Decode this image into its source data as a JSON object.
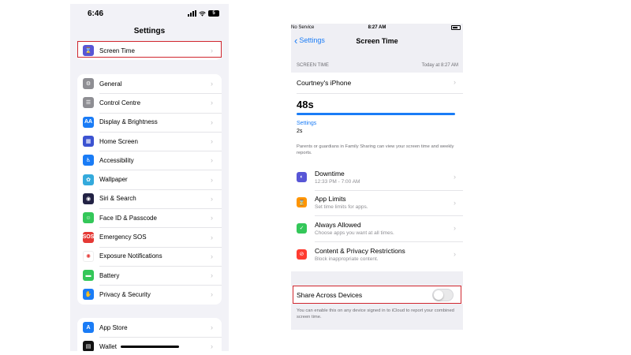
{
  "left_phone": {
    "status_bar": {
      "time": "6:46",
      "battery": "5"
    },
    "title": "Settings",
    "top_group": [
      {
        "label": "Screen Time",
        "icon": "hourglass-icon",
        "color": "#5856d6",
        "glyph": "⌛"
      }
    ],
    "main_group": [
      {
        "label": "General",
        "icon": "gear-icon",
        "color": "#8e8e93",
        "glyph": "⚙"
      },
      {
        "label": "Control Centre",
        "icon": "control-centre-icon",
        "color": "#8e8e93",
        "glyph": "☰"
      },
      {
        "label": "Display & Brightness",
        "icon": "display-icon",
        "color": "#1a7cf6",
        "glyph": "AA"
      },
      {
        "label": "Home Screen",
        "icon": "home-screen-icon",
        "color": "#3c53d1",
        "glyph": "▦"
      },
      {
        "label": "Accessibility",
        "icon": "accessibility-icon",
        "color": "#1a7cf6",
        "glyph": "♿"
      },
      {
        "label": "Wallpaper",
        "icon": "wallpaper-icon",
        "color": "#34aadc",
        "glyph": "✿"
      },
      {
        "label": "Siri & Search",
        "icon": "siri-icon",
        "color": "#222244",
        "glyph": "◉"
      },
      {
        "label": "Face ID & Passcode",
        "icon": "face-id-icon",
        "color": "#34c759",
        "glyph": "☺"
      },
      {
        "label": "Emergency SOS",
        "icon": "sos-icon",
        "color": "#e53935",
        "glyph": "SOS"
      },
      {
        "label": "Exposure Notifications",
        "icon": "exposure-icon",
        "color": "#ffffff",
        "glyph": "✺"
      },
      {
        "label": "Battery",
        "icon": "battery-icon",
        "color": "#34c759",
        "glyph": "▬"
      },
      {
        "label": "Privacy & Security",
        "icon": "hand-icon",
        "color": "#1a7cf6",
        "glyph": "✋"
      }
    ],
    "bottom_group": [
      {
        "label": "App Store",
        "icon": "app-store-icon",
        "color": "#1a7cf6",
        "glyph": "A"
      },
      {
        "label": "Wallet",
        "icon": "wallet-icon",
        "color": "#111111",
        "glyph": "▤"
      }
    ]
  },
  "right_phone": {
    "status_bar": {
      "carrier": "No Service",
      "time": "8:27 AM"
    },
    "nav": {
      "back": "Settings",
      "title": "Screen Time"
    },
    "section_header": "SCREEN TIME",
    "section_timestamp": "Today at 8:27 AM",
    "device_name": "Courtney's iPhone",
    "total_time": "48s",
    "usage_fraction": 1.0,
    "top_category": "Settings",
    "top_category_time": "2s",
    "family_note": "Parents or guardians in Family Sharing can view your screen time and weekly reports.",
    "options": [
      {
        "title": "Downtime",
        "subtitle": "12:33 PM - 7:00 AM",
        "icon": "downtime-icon",
        "color": "#5856d6",
        "glyph": "◐"
      },
      {
        "title": "App Limits",
        "subtitle": "Set time limits for apps.",
        "icon": "app-limits-icon",
        "color": "#ff9500",
        "glyph": "⌛"
      },
      {
        "title": "Always Allowed",
        "subtitle": "Choose apps you want at all times.",
        "icon": "always-allowed-icon",
        "color": "#34c759",
        "glyph": "✓"
      },
      {
        "title": "Content & Privacy Restrictions",
        "subtitle": "Block inappropriate content.",
        "icon": "restrictions-icon",
        "color": "#ff3b30",
        "glyph": "⊘"
      }
    ],
    "share_label": "Share Across Devices",
    "share_enabled": false,
    "share_note": "You can enable this on any device signed in to iCloud to report your combined screen time."
  }
}
